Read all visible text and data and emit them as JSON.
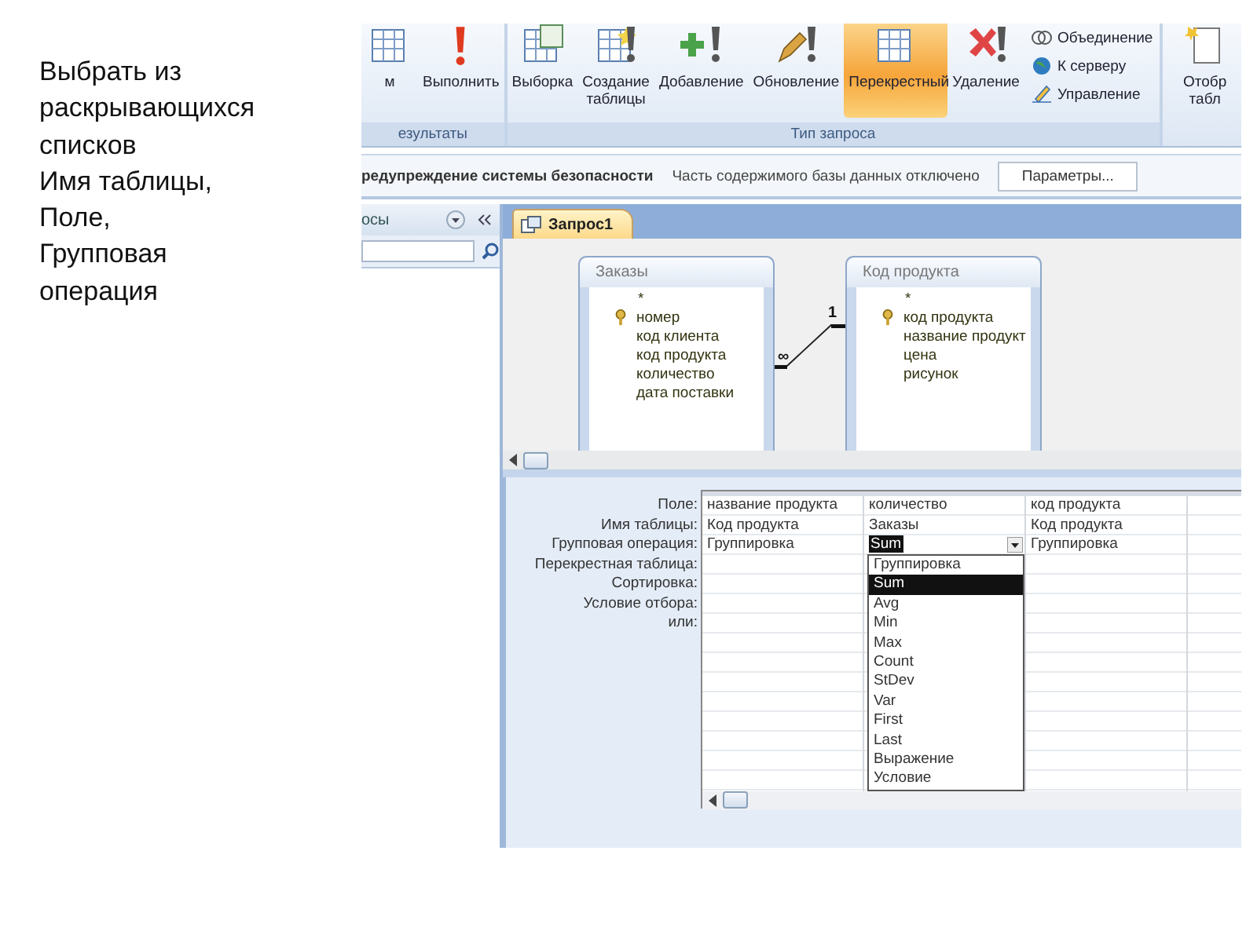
{
  "slide_text": "Выбрать из раскрывающихся списков\nИмя таблицы,\nПоле,\n Групповая операция",
  "ribbon": {
    "groups": [
      {
        "label": "езультаты",
        "buttons": [
          {
            "label": "м",
            "selected": false
          },
          {
            "label": "Выполнить",
            "selected": false
          }
        ]
      },
      {
        "label": "Тип запроса",
        "buttons": [
          {
            "label": "Выборка",
            "selected": false
          },
          {
            "label": "Создание таблицы",
            "selected": false
          },
          {
            "label": "Добавление",
            "selected": false
          },
          {
            "label": "Обновление",
            "selected": false
          },
          {
            "label": "Перекрестный",
            "selected": true
          },
          {
            "label": "Удаление",
            "selected": false
          }
        ],
        "small": [
          "Объединение",
          "К серверу",
          "Управление"
        ]
      },
      {
        "buttons": [
          {
            "label": "Отобр табл",
            "selected": false
          }
        ]
      }
    ]
  },
  "security_bar": {
    "title": "редупреждение системы безопасности",
    "message": "Часть содержимого базы данных отключено",
    "button": "Параметры..."
  },
  "nav_pane": {
    "title": "осы"
  },
  "tabs": [
    {
      "label": "Запрос1",
      "selected": true
    }
  ],
  "diagram": {
    "tables": [
      {
        "title": "Заказы",
        "fields": [
          {
            "name": "*",
            "key": false
          },
          {
            "name": "номер",
            "key": true
          },
          {
            "name": "код клиента",
            "key": false
          },
          {
            "name": "код продукта",
            "key": false
          },
          {
            "name": "количество",
            "key": false
          },
          {
            "name": "дата поставки",
            "key": false
          }
        ]
      },
      {
        "title": "Код продукта",
        "fields": [
          {
            "name": "*",
            "key": false
          },
          {
            "name": "код продукта",
            "key": true
          },
          {
            "name": "название продукт",
            "key": false
          },
          {
            "name": "цена",
            "key": false
          },
          {
            "name": "рисунок",
            "key": false
          }
        ]
      }
    ],
    "relation": {
      "many": "∞",
      "one": "1"
    }
  },
  "grid": {
    "row_labels": [
      "Поле:",
      "Имя таблицы:",
      "Групповая операция:",
      "Перекрестная таблица:",
      "Сортировка:",
      "Условие отбора:",
      "или:"
    ],
    "columns": [
      {
        "field": "название продукта",
        "table": "Код продукта",
        "total": "Группировка",
        "active": false
      },
      {
        "field": "количество",
        "table": "Заказы",
        "total": "Sum",
        "active": true,
        "options": [
          {
            "label": "Группировка",
            "selected": false
          },
          {
            "label": "Sum",
            "selected": true
          },
          {
            "label": "Avg",
            "selected": false
          },
          {
            "label": "Min",
            "selected": false
          },
          {
            "label": "Max",
            "selected": false
          },
          {
            "label": "Count",
            "selected": false
          },
          {
            "label": "StDev",
            "selected": false
          },
          {
            "label": "Var",
            "selected": false
          },
          {
            "label": "First",
            "selected": false
          },
          {
            "label": "Last",
            "selected": false
          },
          {
            "label": "Выражение",
            "selected": false
          },
          {
            "label": "Условие",
            "selected": false
          }
        ]
      },
      {
        "field": "код продукта",
        "table": "Код продукта",
        "total": "Группировка",
        "active": false
      }
    ]
  }
}
